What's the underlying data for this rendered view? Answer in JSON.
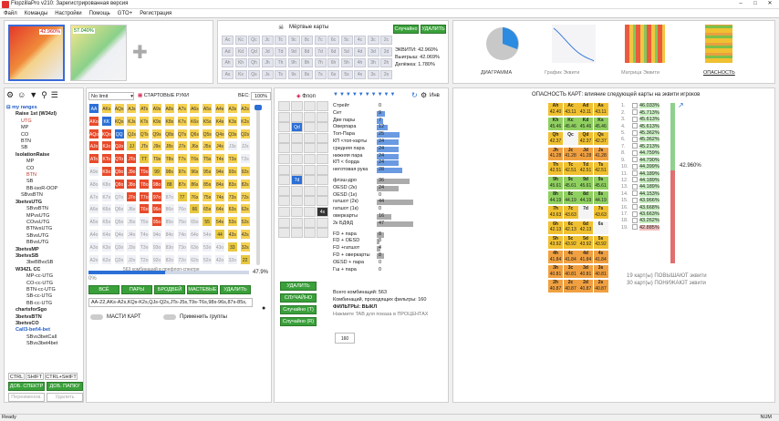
{
  "app": {
    "title": "FlopzillaPro v210: Зарегистрированная версия"
  },
  "menu": [
    "Файл",
    "Команды",
    "Настройки",
    "Помощь",
    "GTO+",
    "Регистрация"
  ],
  "top": {
    "range1_pct": "42.960%",
    "range2_pct": "57.040%",
    "dead_cards": "Мёртвые карты",
    "random": "Случайно",
    "remove": "УДАЛИТЬ",
    "equity": "ЭКВИТИ: 42.960%",
    "win": "Выигрыш: 42.069%",
    "tie": "Делёжка: 1.780%",
    "tabs": [
      "ДИАГРАММА",
      "График Эквити",
      "Матрица Эквити",
      "ОПАСНОСТЬ"
    ]
  },
  "deck": {
    "rows": [
      [
        "Ac",
        "Kc",
        "Qc",
        "Jc",
        "Tc",
        "9c",
        "8c",
        "7c",
        "6c",
        "5c",
        "4c",
        "3c",
        "2c"
      ],
      [
        "Ad",
        "Kd",
        "Qd",
        "Jd",
        "Td",
        "9d",
        "8d",
        "7d",
        "6d",
        "5d",
        "4d",
        "3d",
        "2d"
      ],
      [
        "Ah",
        "Kh",
        "Qh",
        "Jh",
        "Th",
        "9h",
        "8h",
        "7h",
        "6h",
        "5h",
        "4h",
        "3h",
        "2h"
      ],
      [
        "As",
        "Ks",
        "Qs",
        "Js",
        "Ts",
        "9s",
        "8s",
        "7s",
        "6s",
        "5s",
        "4s",
        "3s",
        "2s"
      ]
    ]
  },
  "left": {
    "title": "my ranges",
    "items": [
      "Raise 1st (W34zl)",
      "UTG",
      "MP",
      "CO",
      "BTN",
      "SB",
      "IsolationRaise",
      "MP",
      "CO",
      "BTN",
      "SB",
      "BB-isoR-OOP",
      "SBvsBTN",
      "3betvsUTG",
      "SBvsBTN",
      "MPvsUTG",
      "COvsUTG",
      "BTNvsUTG",
      "SBvsUTG",
      "BBvsUTG",
      "3betvsMP",
      "3betvsSB",
      "3beBBvsSB",
      "W34ZL CC",
      "MP-cc-UTG",
      "CO-cc-UTG",
      "BTN-cc-UTG",
      "SB-cc-UTG",
      "BB-cc-UTG",
      "chartsforSgo",
      "3betvsBTN",
      "3betvsCO",
      "Call3-bet\\4-bet",
      "SBvs3betCall",
      "SBvs3bet4bet"
    ],
    "keys": [
      "CTRL",
      "SHIFT",
      "CTRL+SHIFT"
    ],
    "add_spectrum": "ДОБ. СПЕКТР",
    "add_folder": "ДОБ. ПАПКУ",
    "rename": "Переименов.",
    "delete": "Удалить"
  },
  "matrix": {
    "mode": "No limit",
    "start_hands": "СТАРТОВЫЕ РУКИ",
    "weight_label": "ВЕС:",
    "weight": "100%",
    "combos": "563 комбинаций в префлоп-спектре",
    "pct": "47.9%",
    "zero": "0%",
    "buttons": [
      "ВСЁ",
      "ПАРЫ",
      "БРОДВЕЙ",
      "МАСТЕВЫЕ",
      "УДАЛИТЬ"
    ],
    "range_text": "AA-22,AKs-A2s,KQs-K2s,QJs-Q2s,JTs-J5s,T9s-T6s,98s-96s,87s-85s,",
    "suits_toggle": "МАСТИ КАРТ",
    "groups_toggle": "Применить группы"
  },
  "flop": {
    "label": "Флоп",
    "inv": "Инв",
    "delete": "УДАЛИТЬ",
    "random": "СЛУЧАЙНО",
    "random_t": "Случайно (T)",
    "random_r": "Случайно (R)",
    "filters": [
      {
        "n": "Стрейт",
        "v": "0"
      },
      {
        "n": "Сет",
        "v": "9"
      },
      {
        "n": "Две пары",
        "v": "7"
      },
      {
        "n": "Оверпара",
        "v": "12"
      },
      {
        "n": "Топ-Пара",
        "v": "25"
      },
      {
        "n": "КП <топ-карты",
        "v": "24"
      },
      {
        "n": "средняя пара",
        "v": "24"
      },
      {
        "n": "нижняя пара",
        "v": "24"
      },
      {
        "n": "КП < борда",
        "v": "24"
      },
      {
        "n": "неготовая рука",
        "v": "28"
      },
      {
        "n": "флэш-дро",
        "v": "36"
      },
      {
        "n": "OESD (2к)",
        "v": "24"
      },
      {
        "n": "OESD (1к)",
        "v": "0"
      },
      {
        "n": "гатшот (2к)",
        "v": "44"
      },
      {
        "n": "гатшот (1к)",
        "v": "0"
      },
      {
        "n": "оверкарты",
        "v": "16"
      },
      {
        "n": "2к БДФД",
        "v": "47"
      },
      {
        "n": "FD + пара",
        "v": "8"
      },
      {
        "n": "FD + OESD",
        "v": "3"
      },
      {
        "n": "FD +гатшот",
        "v": "4"
      },
      {
        "n": "FD + оверкарты",
        "v": "8"
      },
      {
        "n": "OESD + пара",
        "v": "0"
      },
      {
        "n": "Гш + пара",
        "v": "0"
      }
    ],
    "total": "Всего комбинаций: 563",
    "passing": "Комбинаций, проходящих фильтры: 160",
    "filters_state": "ФИЛЬТРЫ: ВЫКЛ",
    "hint": "Нажмите TAB для показа в ПРОЦЕНТАХ",
    "badge": "160"
  },
  "danger": {
    "title": "ОПАСНОСТЬ КАРТ: влияние следующей карты на эквити игроков",
    "baseline": "42.960%",
    "up": "19 карт(ы) ПОВЫШАЮТ эквити",
    "down": "30 карт(ы) ПОНИЖАЮТ эквити",
    "grid": [
      [
        "Ah",
        "Ac",
        "Ad",
        "As"
      ],
      [
        "42.40",
        "43.11",
        "43.11",
        "43.11"
      ],
      [
        "Kh",
        "Kc",
        "Kd",
        "Ks"
      ],
      [
        "45.46",
        "45.46",
        "45.46",
        "45.46"
      ],
      [
        "Qh",
        "Qc",
        "Qd",
        "Qs"
      ],
      [
        "42.37",
        "",
        "42.37",
        "42.37"
      ],
      [
        "Jh",
        "Jc",
        "Jd",
        "Js"
      ],
      [
        "41.28",
        "41.28",
        "41.28",
        "41.28"
      ],
      [
        "Th",
        "Tc",
        "Td",
        "Ts"
      ],
      [
        "42.51",
        "42.51",
        "42.51",
        "42.51"
      ],
      [
        "9h",
        "9c",
        "9d",
        "9s"
      ],
      [
        "45.61",
        "45.61",
        "45.61",
        "45.61"
      ],
      [
        "8h",
        "8c",
        "8d",
        "8s"
      ],
      [
        "44.19",
        "44.19",
        "44.19",
        "44.19"
      ],
      [
        "7h",
        "7c",
        "7d",
        "7s"
      ],
      [
        "43.63",
        "43.63",
        "",
        "43.63"
      ],
      [
        "6h",
        "6c",
        "6d",
        "6s"
      ],
      [
        "42.13",
        "42.13",
        "42.13",
        ""
      ],
      [
        "5h",
        "5c",
        "5d",
        "5s"
      ],
      [
        "43.92",
        "43.92",
        "43.92",
        "43.92"
      ],
      [
        "4h",
        "4c",
        "4d",
        "4s"
      ],
      [
        "41.84",
        "41.84",
        "41.84",
        "41.84"
      ],
      [
        "3h",
        "3c",
        "3d",
        "3s"
      ],
      [
        "40.81",
        "40.81",
        "40.81",
        "40.81"
      ],
      [
        "2h",
        "2c",
        "2d",
        "2s"
      ],
      [
        "40.87",
        "40.87",
        "40.87",
        "40.87"
      ]
    ],
    "list": [
      "46.033%",
      "45.713%",
      "45.613%",
      "45.613%",
      "45.362%",
      "45.362%",
      "45.213%",
      "44.759%",
      "44.790%",
      "44.399%",
      "44.189%",
      "44.189%",
      "44.189%",
      "44.153%",
      "43.966%",
      "43.668%",
      "43.663%",
      "43.262%",
      "42.885%"
    ]
  },
  "status": {
    "left": "Ready",
    "right": "NUM"
  }
}
